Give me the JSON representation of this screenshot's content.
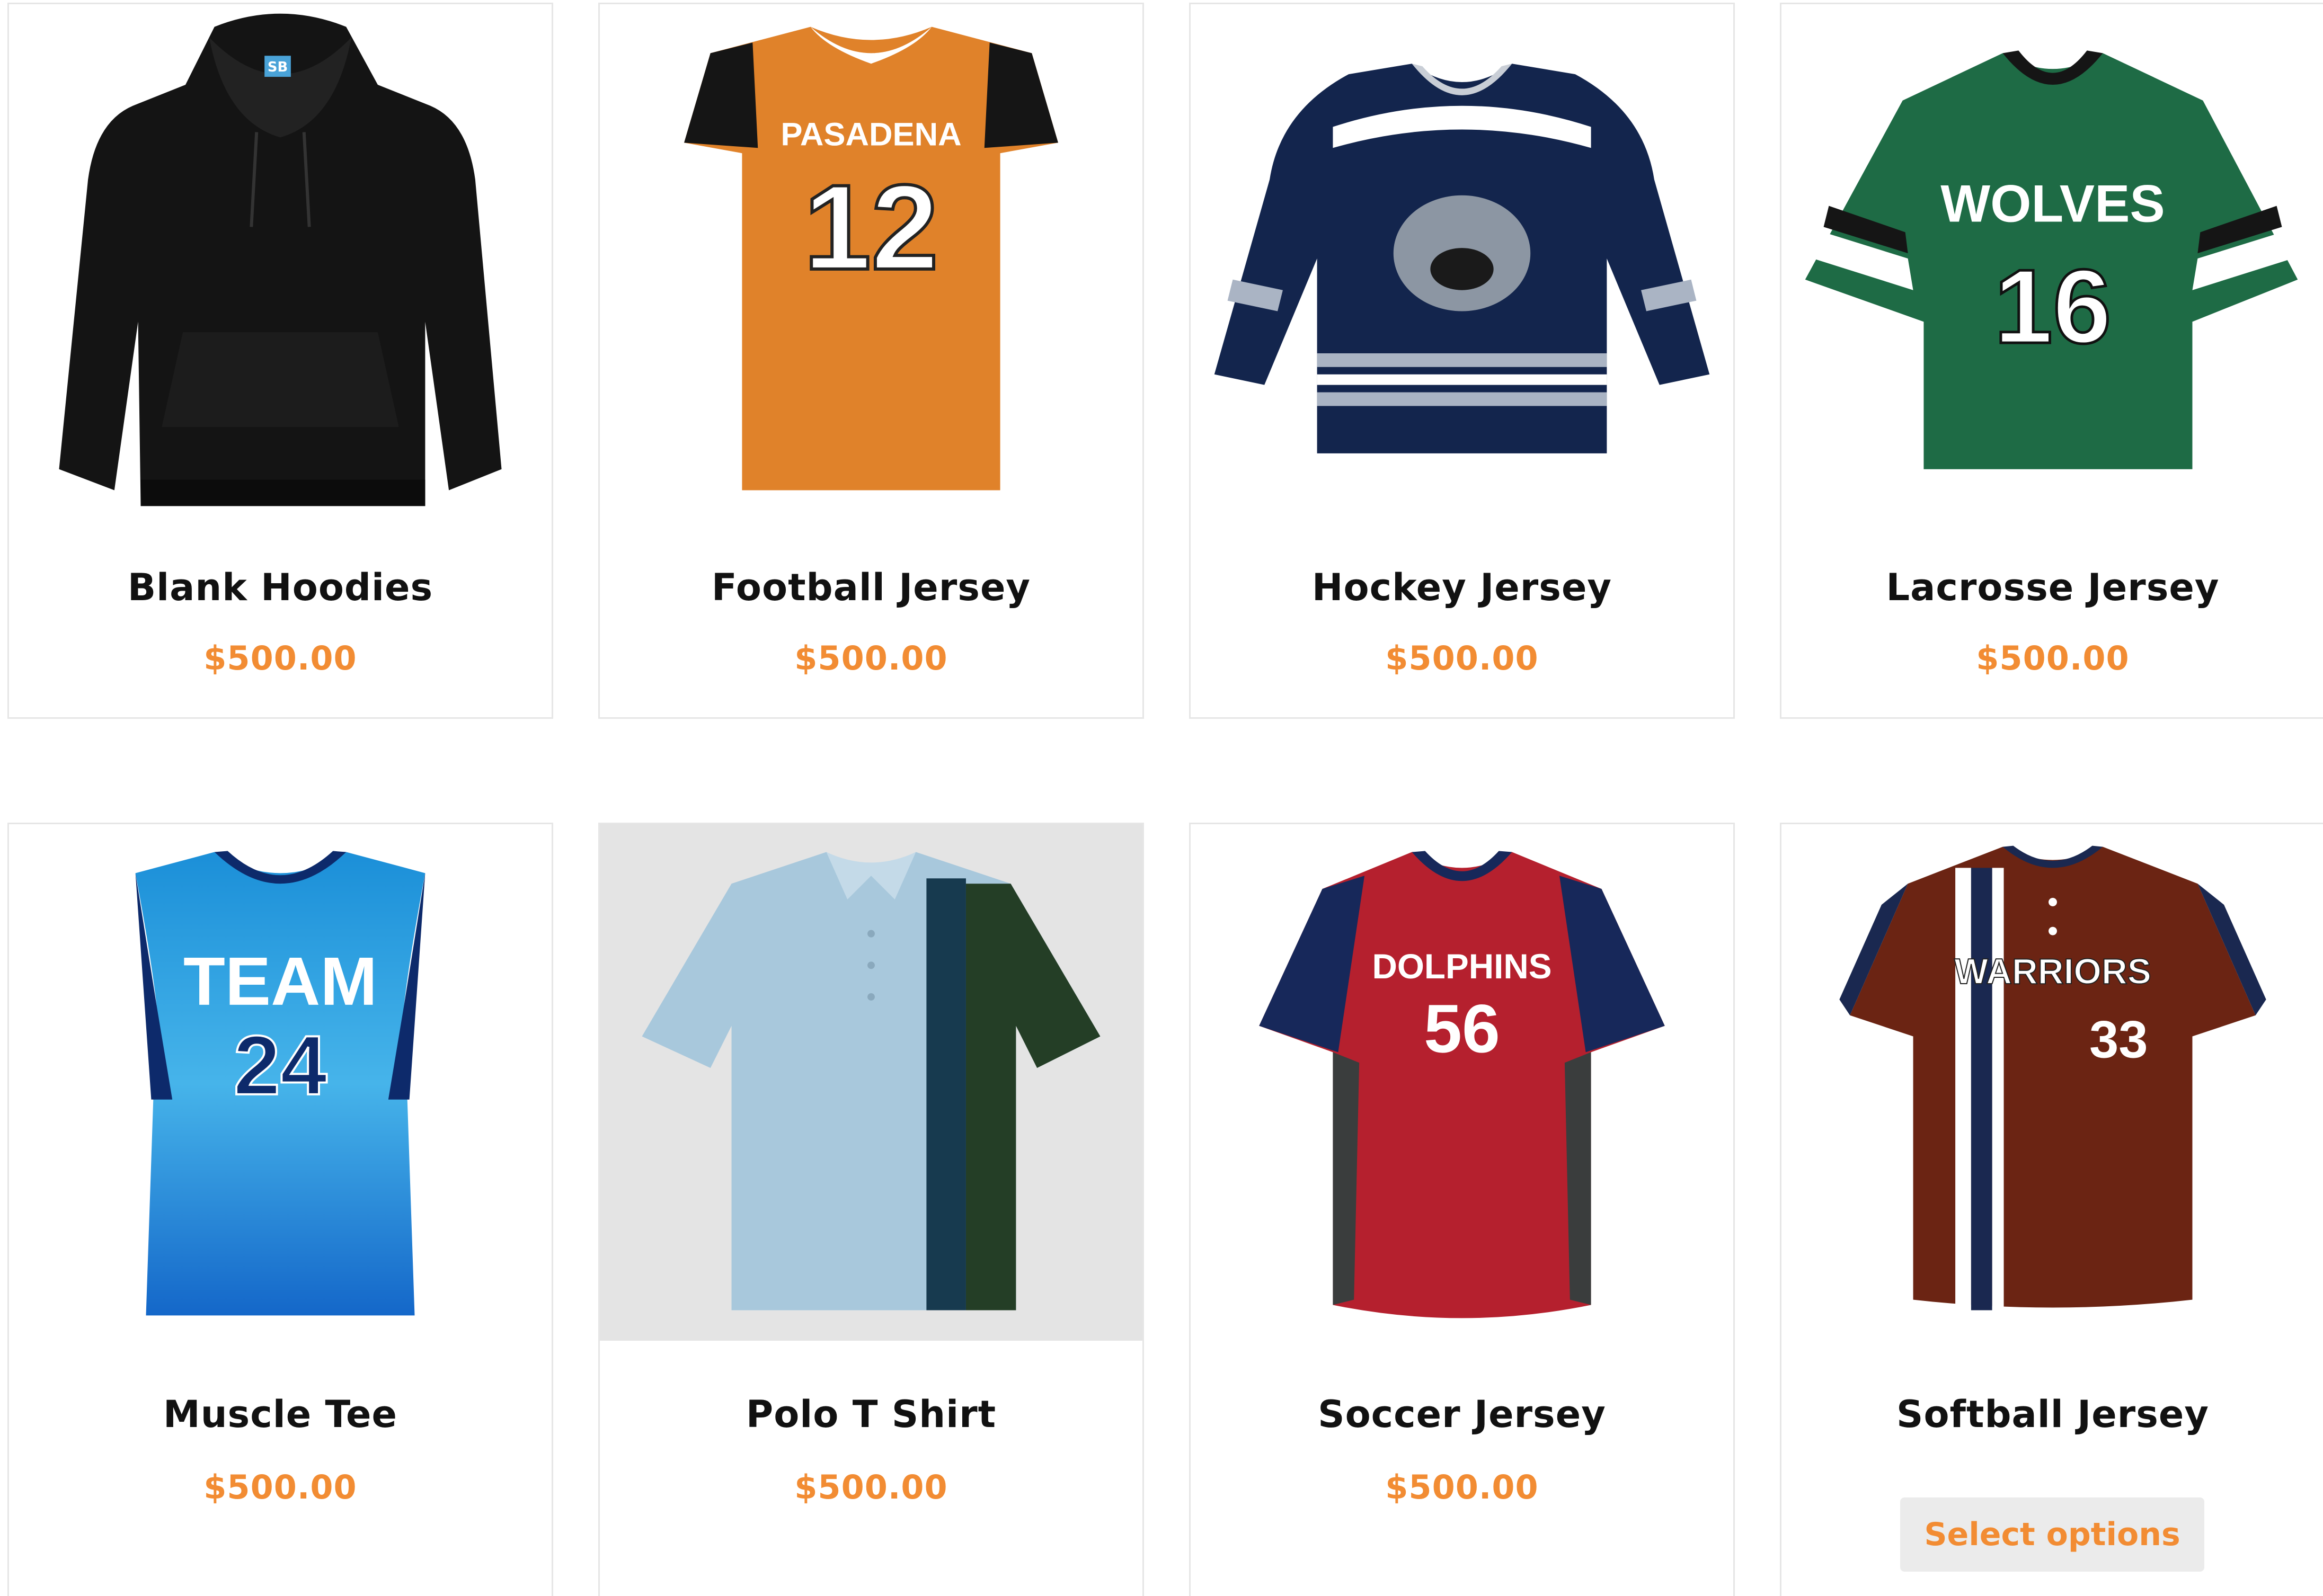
{
  "products": [
    {
      "name": "Blank Hoodies",
      "price": "$500.00",
      "image": "black-hoodie",
      "logo_text": "SB"
    },
    {
      "name": "Football Jersey",
      "price": "$500.00",
      "image": "orange-football-jersey",
      "team": "PASADENA",
      "number": "12"
    },
    {
      "name": "Hockey Jersey",
      "price": "$500.00",
      "image": "navy-hockey-jersey"
    },
    {
      "name": "Lacrosse Jersey",
      "price": "$500.00",
      "image": "green-lacrosse-jersey",
      "team": "WOLVES",
      "number": "16"
    },
    {
      "name": "Muscle Tee",
      "price": "$500.00",
      "image": "blue-muscle-tee",
      "team": "TEAM",
      "number": "24"
    },
    {
      "name": "Polo T Shirt",
      "price": "$500.00",
      "image": "light-blue-polo-shirt"
    },
    {
      "name": "Soccer Jersey",
      "price": "$500.00",
      "image": "red-soccer-jersey",
      "team": "DOLPHINS",
      "number": "56"
    },
    {
      "name": "Softball Jersey",
      "image": "brown-softball-jersey",
      "team": "WARRIORS",
      "number": "33",
      "button_label": "Select options"
    }
  ],
  "colors": {
    "price": "#f28c33",
    "title": "#111111",
    "card_border": "#e6e6e6",
    "button_bg": "#ebebeb"
  }
}
